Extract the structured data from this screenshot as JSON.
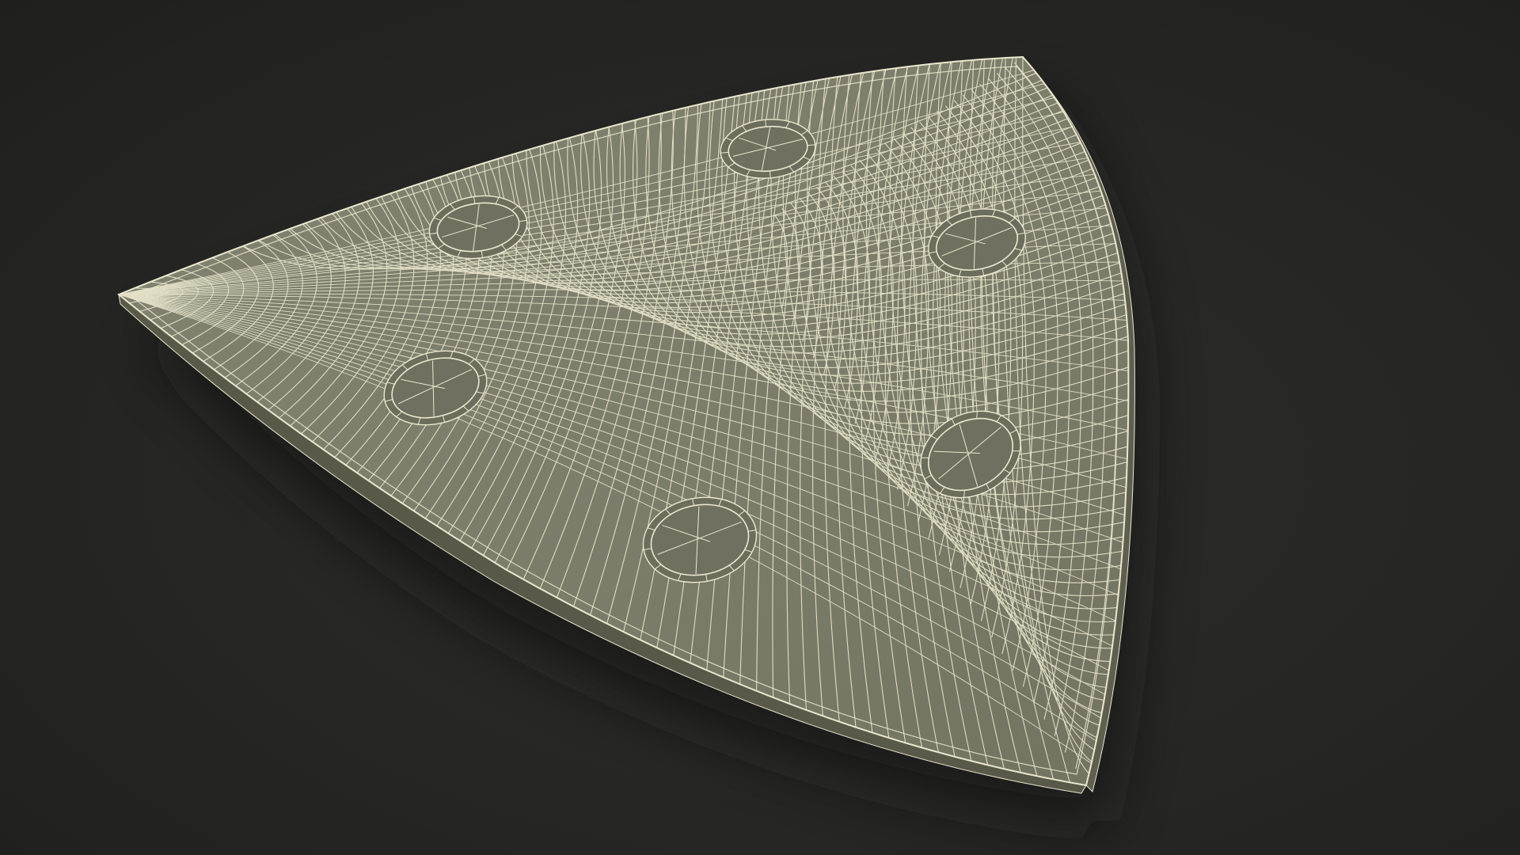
{
  "scene": {
    "subject": "wireframe-triangular-sanding-pad",
    "colors": {
      "background": "#262624",
      "surface": "#7c7d6a",
      "surface_shade": "#6c6d5c",
      "edge": "#5d5e4f",
      "wire": "#ece8cf",
      "hole": "#6f705f",
      "shadow": "#141413"
    },
    "holes_count": 6
  }
}
